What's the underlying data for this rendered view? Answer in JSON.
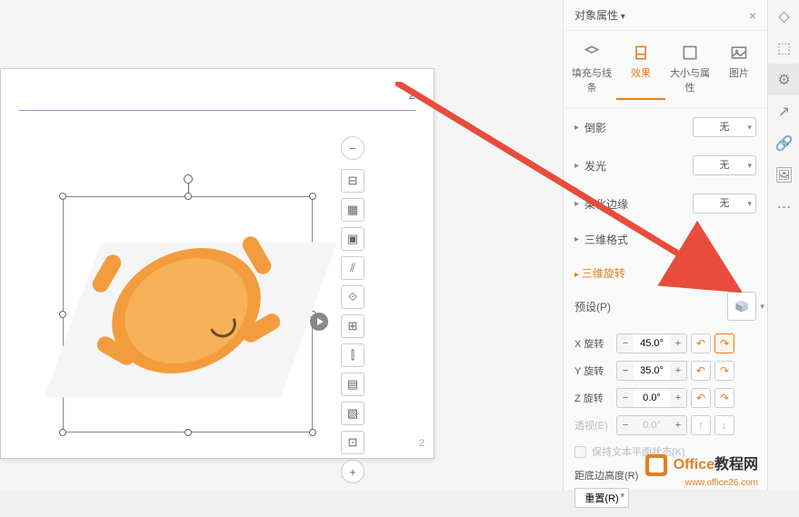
{
  "panel": {
    "title": "对象属性",
    "tabs": {
      "fill": "填充与线条",
      "effect": "效果",
      "size": "大小与属性",
      "picture": "图片"
    }
  },
  "sections": {
    "shadow": {
      "label": "倒影",
      "value": "无"
    },
    "glow": {
      "label": "发光",
      "value": "无"
    },
    "soft_edge": {
      "label": "柔化边缘",
      "value": "无"
    },
    "three_d": {
      "label": "三维格式"
    }
  },
  "rotation": {
    "title": "三维旋转",
    "preset_label": "预设(P)",
    "x_label": "X 旋转",
    "y_label": "Y 旋转",
    "z_label": "Z 旋转",
    "perspective_label": "透视(E)",
    "x_value": "45.0°",
    "y_value": "35.0°",
    "z_value": "0.0°",
    "perspective_value": "0.0°",
    "keep_text_flat": "保持文本平面状态(K)",
    "distance_label": "距底边高度(R)",
    "reset_label": "重置(R)"
  },
  "slide": {
    "number_top": "2",
    "number_bottom": "2"
  },
  "toolbar_icons": [
    "⊟",
    "▦",
    "▣",
    "⫽",
    "⟐",
    "⊞",
    "⫿",
    "▤",
    "▧",
    "⊡",
    "◫"
  ],
  "zoom_icons": [
    "−",
    "+"
  ],
  "watermark": {
    "text1": "Office",
    "text2": "教程网",
    "url": "www.office26.com"
  }
}
